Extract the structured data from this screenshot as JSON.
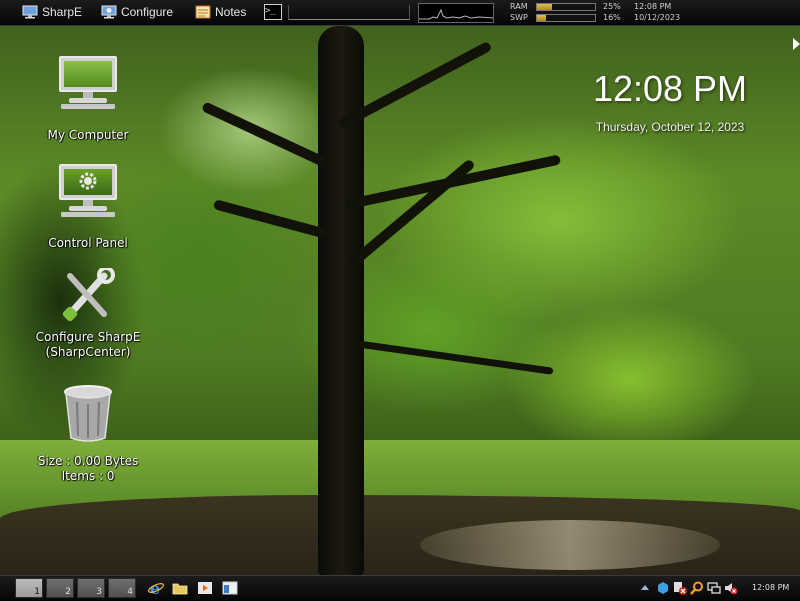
{
  "top_panel": {
    "menus": [
      {
        "label": "SharpE",
        "icon": "monitor-icon"
      },
      {
        "label": "Configure",
        "icon": "monitor-gear-icon"
      },
      {
        "label": "Notes",
        "icon": "notes-icon"
      }
    ],
    "terminal_icon": "terminal-icon",
    "terminal_glyph": ">_",
    "meters": {
      "ram": {
        "label": "RAM",
        "percent_text": "25%",
        "value": 25
      },
      "swp": {
        "label": "SWP",
        "percent_text": "16%",
        "value": 16
      }
    },
    "time": "12:08 PM",
    "date": "10/12/2023"
  },
  "desktop": {
    "icons": [
      {
        "label": "My Computer",
        "icon": "computer-icon"
      },
      {
        "label": "Control Panel",
        "icon": "control-panel-icon"
      },
      {
        "label_line1": "Configure SharpE",
        "label_line2": "(SharpCenter)",
        "icon": "tools-icon"
      },
      {
        "label_line1": "Size : 0.00 Bytes",
        "label_line2": "Items : 0",
        "icon": "recycle-bin-icon"
      }
    ],
    "clock": {
      "time": "12:08 PM",
      "date": "Thursday, October 12, 2023"
    }
  },
  "taskbar": {
    "workspaces": [
      "1",
      "2",
      "3",
      "4"
    ],
    "active_workspace": "1",
    "quick_launch": [
      "internet-explorer-icon",
      "folder-icon",
      "media-player-icon",
      "window-icon"
    ],
    "tray_icons": [
      "tray-expand-icon",
      "dropbox-icon",
      "network-error-icon",
      "search-icon",
      "display-icon",
      "volume-muted-icon"
    ],
    "clock": "12:08 PM"
  },
  "colors": {
    "panel": "#0a0a0a",
    "meter_fill": "#c8a030",
    "foliage": "#6fa82c"
  }
}
